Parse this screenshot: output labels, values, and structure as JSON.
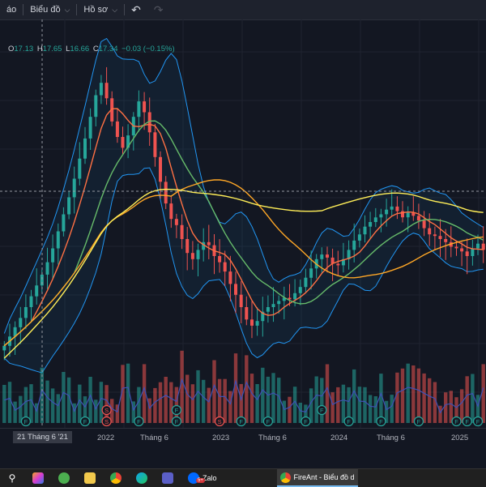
{
  "toolbar": {
    "menu_view": "áo",
    "menu_chart": "Biểu đồ",
    "menu_profile": "Hồ sơ",
    "undo_icon": "undo-arrow",
    "redo_icon": "redo-arrow"
  },
  "ohlc": {
    "o_key": "O",
    "o_val": "17.13",
    "h_key": "H",
    "h_val": "17.65",
    "l_key": "L",
    "l_val": "16.66",
    "c_key": "C",
    "c_val": "17.34",
    "change": "−0.03 (−0.15%)"
  },
  "colors": {
    "background": "#131722",
    "up": "#26a69a",
    "down": "#ef5350",
    "bollinger": "#2196f3",
    "ma_orange": "#ff7043",
    "ma_green": "#66bb6a",
    "ma_gold": "#ffa726",
    "ma_yellow": "#ffee58",
    "volume_avg": "#3f51b5"
  },
  "xaxis": {
    "crosshair_label": "21 Tháng 6 '21",
    "labels": [
      "2022",
      "Tháng 6",
      "2023",
      "Tháng 6",
      "2024",
      "Tháng 6",
      "2025"
    ]
  },
  "chart_data": {
    "type": "line",
    "series": [
      {
        "values": [
          7.0,
          7.6,
          8.2,
          8.8,
          9.5,
          10.2,
          10.9,
          11.6,
          12.4,
          13.3,
          14.4,
          15.5,
          16.6,
          17.8,
          19.1,
          20.4,
          21.8,
          23.2,
          24.0,
          23.0,
          21.5,
          20.5,
          19.8,
          20.6,
          21.8,
          22.8,
          22.1,
          20.8,
          19.2,
          17.6,
          16.2,
          15.2,
          14.8,
          13.9,
          13.0,
          12.6,
          13.2,
          13.7,
          13.5,
          12.8,
          12.4,
          11.8,
          11.0,
          10.3,
          9.5,
          8.7,
          8.3,
          8.6,
          9.2,
          9.5,
          9.7,
          9.9,
          10.1,
          10.0,
          10.4,
          10.8,
          11.4,
          12.0,
          12.6,
          12.9,
          12.7,
          12.3,
          12.2,
          12.6,
          13.2,
          13.8,
          14.2,
          14.7,
          15.0,
          15.3,
          15.5,
          15.8,
          16.0,
          15.7,
          15.3,
          15.6,
          15.4,
          15.1,
          14.6,
          14.2,
          14.1,
          13.9,
          13.7,
          13.4,
          13.3,
          13.1,
          12.8,
          13.3,
          13.6,
          13.2
        ]
      }
    ],
    "ylim": [
      4,
      26
    ]
  },
  "taskbar": {
    "zalo_label": "Zalo",
    "zalo_badge": "5+",
    "window_title": "FireAnt - Biểu đồ d..."
  }
}
